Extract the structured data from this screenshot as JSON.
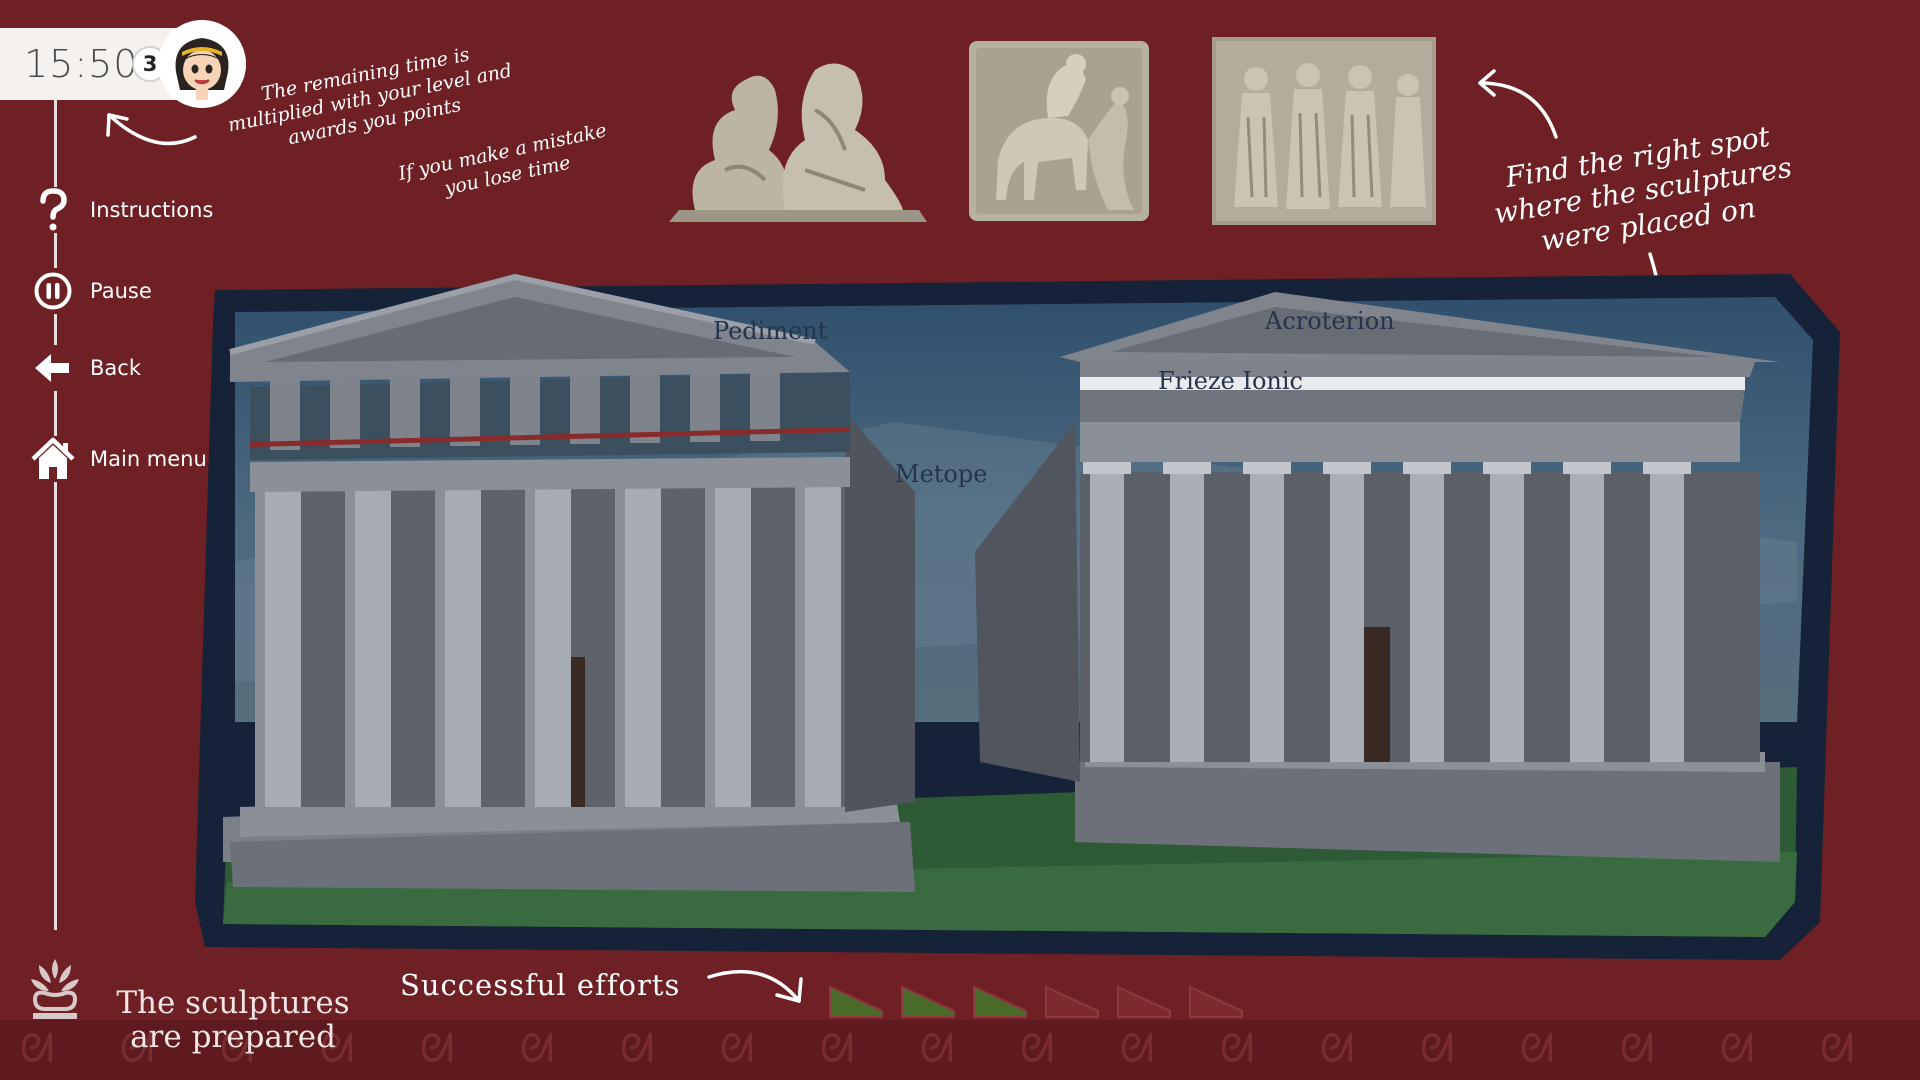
{
  "hud": {
    "timer": "15:50",
    "level": "3",
    "avatar_icon": "cartoon-greek-girl-avatar"
  },
  "sidebar": {
    "items": [
      {
        "label": "Instructions",
        "icon": "question-icon"
      },
      {
        "label": "Pause",
        "icon": "pause-icon"
      },
      {
        "label": "Back",
        "icon": "back-arrow-icon"
      },
      {
        "label": "Main menu",
        "icon": "home-icon"
      }
    ]
  },
  "hints": {
    "timer_hint": "The remaining time is multiplied with your level and awards you points",
    "mistake_hint": "If you make a mistake you lose time",
    "task_hint": "Find the right spot where the sculptures were placed on"
  },
  "sculptures": [
    {
      "name": "pediment-figures-sculpture"
    },
    {
      "name": "metope-centaur-sculpture"
    },
    {
      "name": "frieze-procession-sculpture"
    }
  ],
  "scene": {
    "labels": {
      "pediment": "Pediment",
      "metope": "Metope",
      "acroterion": "Acroterion",
      "frieze_ionic": "Frieze Ionic"
    }
  },
  "status": {
    "message": "The sculptures are prepared",
    "efforts_label": "Successful efforts",
    "efforts_total": 6,
    "efforts_done": 3
  },
  "colors": {
    "background": "#6e2024",
    "frame": "#152238",
    "flag_done": "#4a6a2a",
    "flag_empty": "#7d2a2e"
  }
}
